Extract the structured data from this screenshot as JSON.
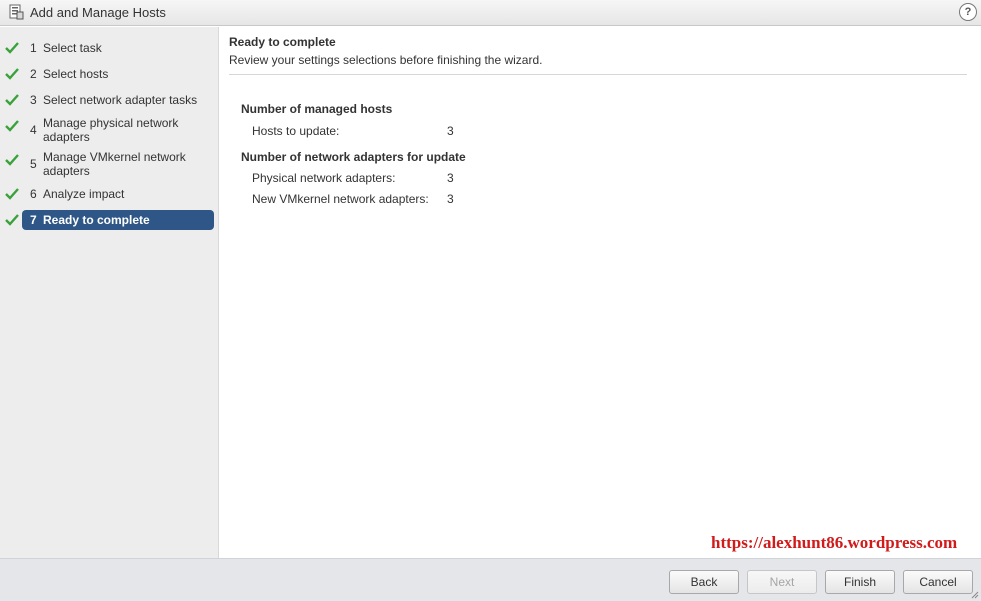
{
  "window": {
    "title": "Add and Manage Hosts",
    "help_icon_text": "?"
  },
  "steps": [
    {
      "num": "1",
      "label": "Select task",
      "status": "done"
    },
    {
      "num": "2",
      "label": "Select hosts",
      "status": "done"
    },
    {
      "num": "3",
      "label": "Select network adapter tasks",
      "status": "done"
    },
    {
      "num": "4",
      "label": "Manage physical network adapters",
      "status": "done"
    },
    {
      "num": "5",
      "label": "Manage VMkernel network adapters",
      "status": "done"
    },
    {
      "num": "6",
      "label": "Analyze impact",
      "status": "done"
    },
    {
      "num": "7",
      "label": "Ready to complete",
      "status": "active"
    }
  ],
  "content": {
    "heading": "Ready to complete",
    "subheading": "Review your settings selections before finishing the wizard.",
    "sections": [
      {
        "title": "Number of managed hosts",
        "rows": [
          {
            "label": "Hosts to update:",
            "value": "3"
          }
        ]
      },
      {
        "title": "Number of network adapters for update",
        "rows": [
          {
            "label": "Physical network adapters:",
            "value": "3"
          },
          {
            "label": "New VMkernel network adapters:",
            "value": "3"
          }
        ]
      }
    ]
  },
  "watermark": "https://alexhunt86.wordpress.com",
  "buttons": {
    "back": "Back",
    "next": "Next",
    "finish": "Finish",
    "cancel": "Cancel"
  },
  "colors": {
    "active_step_bg": "#2e5787",
    "check_green": "#3aa23a",
    "watermark_red": "#d11a1a"
  }
}
